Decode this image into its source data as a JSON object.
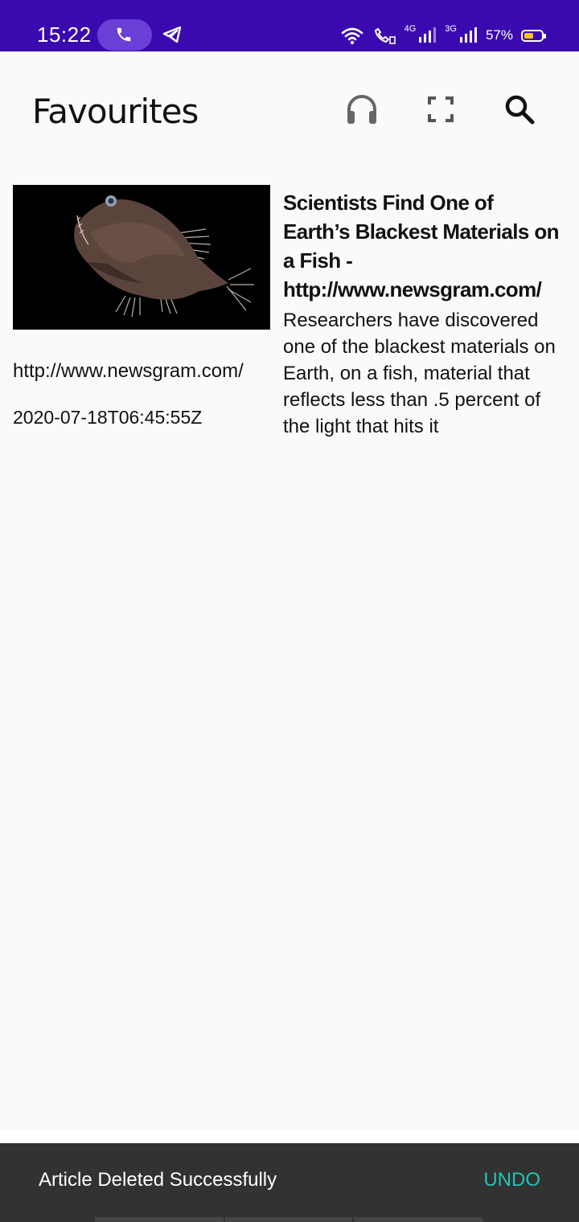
{
  "status_bar": {
    "time": "15:22",
    "network_1": "4G",
    "network_2": "3G",
    "battery_percent": "57%",
    "battery_level": 0.57,
    "colors": {
      "background": "#3a0ab0",
      "call_pill": "#6a3fd6",
      "battery_fill": "#f2c31b"
    }
  },
  "app_bar": {
    "title": "Favourites",
    "icons": [
      "headphones-icon",
      "fullscreen-icon",
      "search-icon"
    ]
  },
  "article": {
    "title": "Scientists Find One of Earth’s Blackest Materials on a Fish - http://www.newsgram.com/",
    "description": "Researchers have discovered one of the blackest materials on Earth, on a fish, material that reflects less than .5 percent of the light that hits it",
    "source": "http://www.newsgram.com/",
    "published_at": "2020-07-18T06:45:55Z",
    "image": "fish-thumbnail"
  },
  "snackbar": {
    "message": "Article Deleted Successfully",
    "action": "UNDO",
    "action_color": "#1fc5b3"
  }
}
